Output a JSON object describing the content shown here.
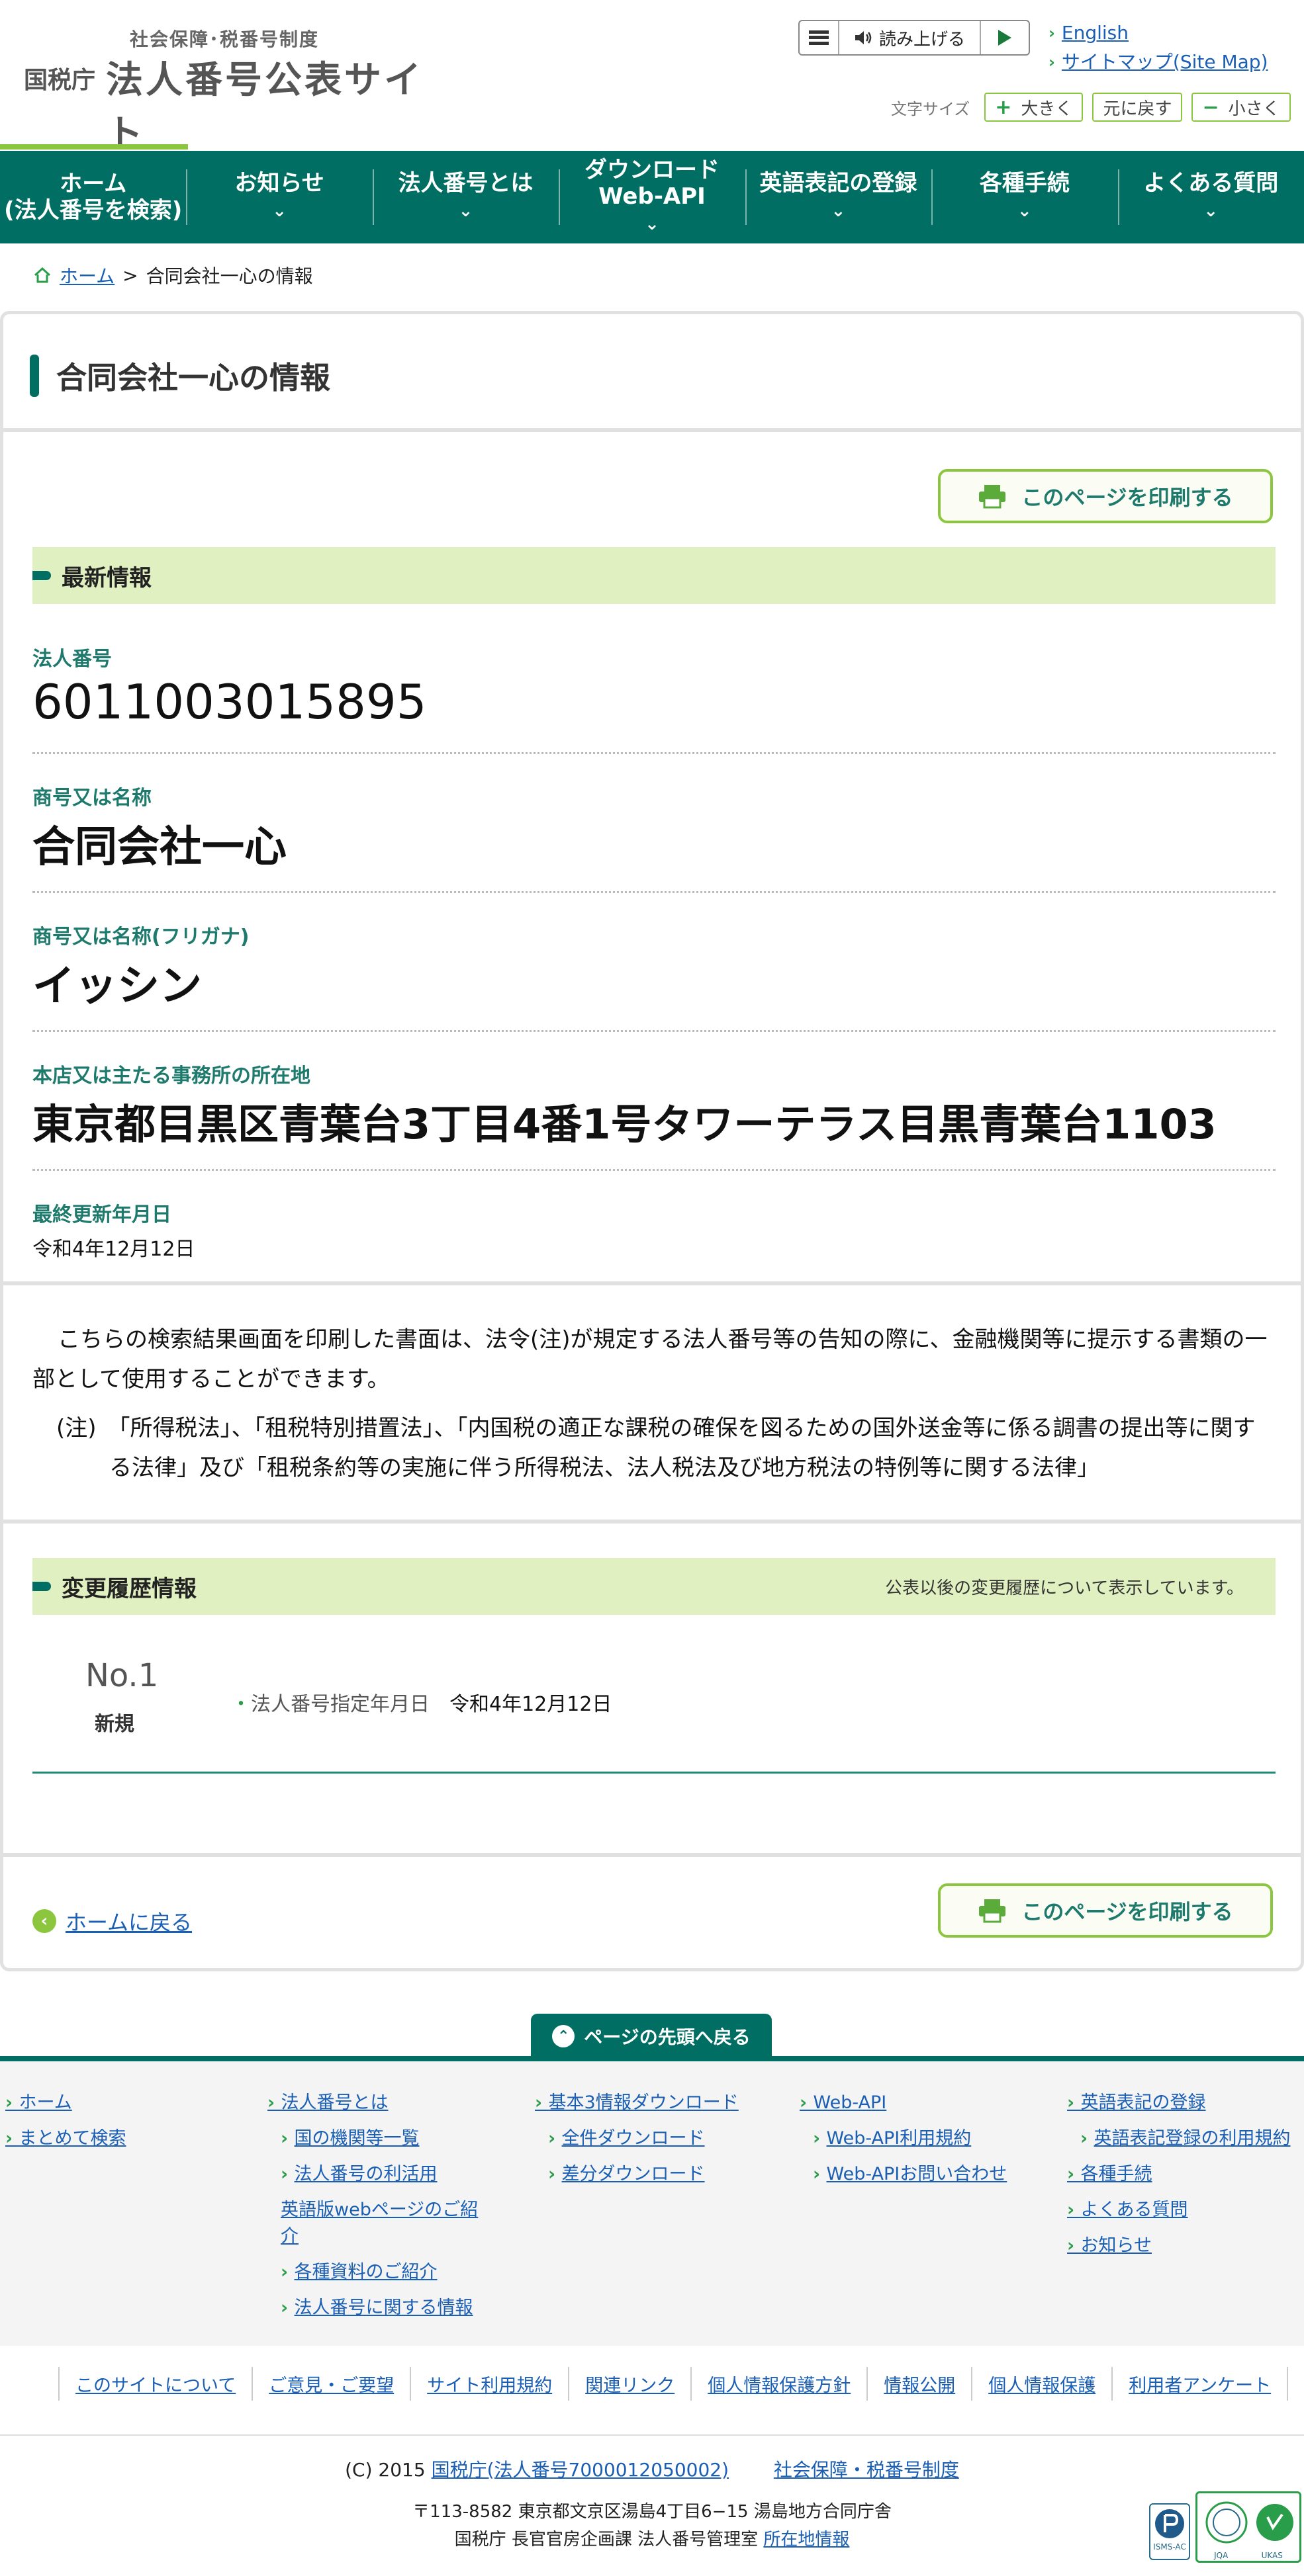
{
  "header": {
    "logo_sub": "社会保障･税番号制度",
    "logo_agency": "国税庁",
    "logo_main": "法人番号公表サイト",
    "read_aloud": "読み上げる",
    "links": [
      "English",
      "サイトマップ(Site Map)"
    ],
    "font_size_label": "文字サイズ",
    "font_buttons": {
      "larger": "大きく",
      "reset": "元に戻す",
      "smaller": "小さく"
    }
  },
  "nav": {
    "items": [
      {
        "line1": "ホーム",
        "line2": "(法人番号を検索)"
      },
      {
        "line1": "お知らせ",
        "line2": ""
      },
      {
        "line1": "法人番号とは",
        "line2": ""
      },
      {
        "line1": "ダウンロード",
        "line2": "Web-API"
      },
      {
        "line1": "英語表記の登録",
        "line2": ""
      },
      {
        "line1": "各種手続",
        "line2": ""
      },
      {
        "line1": "よくある質問",
        "line2": ""
      }
    ]
  },
  "breadcrumb": {
    "home": "ホーム",
    "sep": ">",
    "current": "合同会社一心の情報"
  },
  "main": {
    "title": "合同会社一心の情報",
    "print_label": "このページを印刷する",
    "latest_heading": "最新情報",
    "fields": {
      "corp_number": {
        "label": "法人番号",
        "value": "6011003015895"
      },
      "name": {
        "label": "商号又は名称",
        "value": "合同会社一心"
      },
      "kana": {
        "label": "商号又は名称(フリガナ)",
        "value": "イッシン"
      },
      "address": {
        "label": "本店又は主たる事務所の所在地",
        "value": "東京都目黒区青葉台3丁目4番1号タワーテラス目黒青葉台1103"
      },
      "updated": {
        "label": "最終更新年月日",
        "value": "令和4年12月12日"
      }
    },
    "notice": {
      "p1": "こちらの検索結果画面を印刷した書面は、法令(注)が規定する法人番号等の告知の際に、金融機関等に提示する書類の一部として使用することができます。",
      "p2": "(注)　「所得税法」、「租税特別措置法」、「内国税の適正な課税の確保を図るための国外送金等に係る調書の提出等に関する法律」及び「租税条約等の実施に伴う所得税法、法人税法及び地方税法の特例等に関する法律」"
    },
    "history": {
      "heading": "変更履歴情報",
      "note": "公表以後の変更履歴について表示しています。",
      "entries": [
        {
          "no": "No.1",
          "kind": "新規",
          "key": "法人番号指定年月日",
          "value": "令和4年12月12日"
        }
      ]
    },
    "back_home": "ホームに戻る"
  },
  "page_top": "ページの先頭へ戻る",
  "sitemap": {
    "col1": [
      "ホーム",
      "まとめて検索"
    ],
    "col2": [
      "法人番号とは",
      "国の機関等一覧",
      "法人番号の利活用",
      "英語版webページのご紹介",
      "各種資料のご紹介",
      "法人番号に関する情報"
    ],
    "col3": [
      "基本3情報ダウンロード",
      "全件ダウンロード",
      "差分ダウンロード"
    ],
    "col4": [
      "Web-API",
      "Web-API利用規約",
      "Web-APIお問い合わせ"
    ],
    "col5": [
      "英語表記の登録",
      "英語表記登録の利用規約",
      "各種手続",
      "よくある質問",
      "お知らせ"
    ]
  },
  "footer": {
    "links": [
      "このサイトについて",
      "ご意見・ご要望",
      "サイト利用規約",
      "関連リンク",
      "個人情報保護方針",
      "情報公開",
      "個人情報保護",
      "利用者アンケート"
    ],
    "copyright_prefix": "(C) 2015",
    "copyright_link": "国税庁(法人番号7000012050002)",
    "mynumber_link": "社会保障・税番号制度",
    "address_line1": "〒113-8582  東京都文京区湯島4丁目6−15 湯島地方合同庁舎",
    "address_line2": "国税庁 長官官房企画課 法人番号管理室",
    "location_link": "所在地情報",
    "badges": [
      "ISMS-AC",
      "JQA",
      "UKAS"
    ]
  },
  "colors": {
    "primary": "#006e62",
    "accent": "#8cc63f",
    "band": "#e0f0c0",
    "link": "#1a5fb4"
  }
}
